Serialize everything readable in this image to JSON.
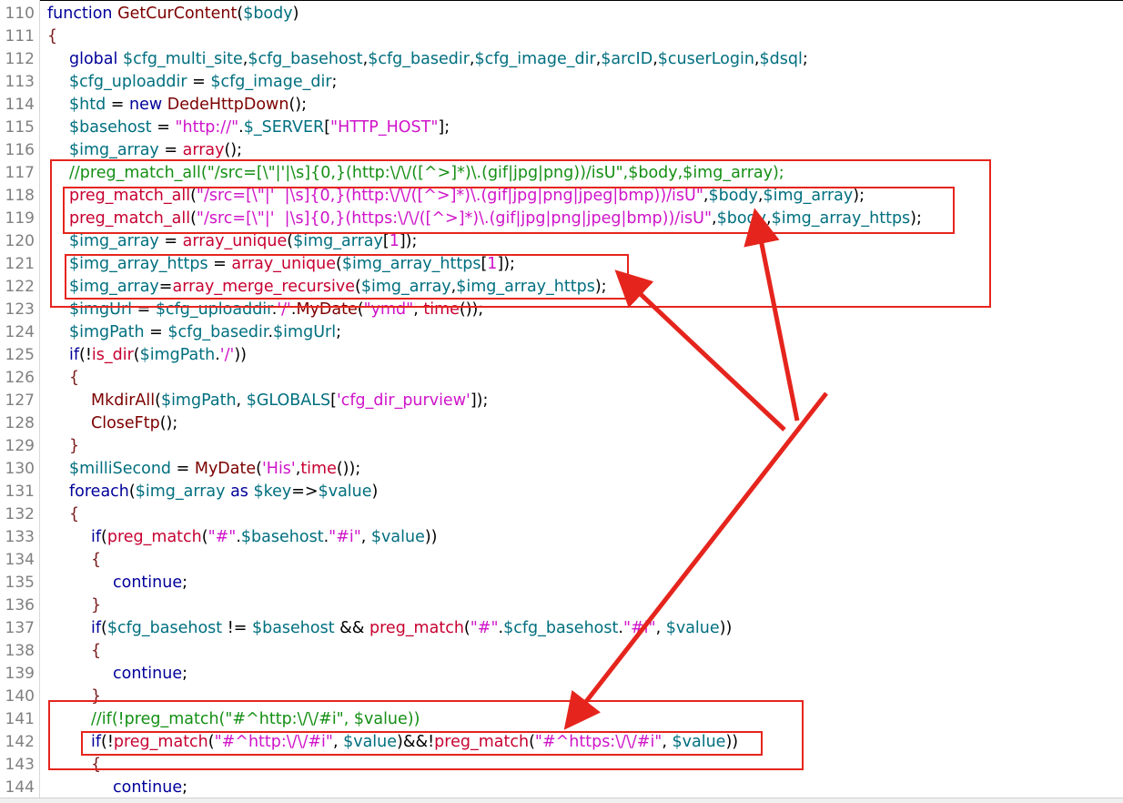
{
  "editor": {
    "lines": [
      {
        "num": "110",
        "indent": 0,
        "tokens": [
          {
            "t": "function ",
            "c": "kw"
          },
          {
            "t": "GetCurContent",
            "c": "fn"
          },
          {
            "t": "(",
            "c": "op"
          },
          {
            "t": "$body",
            "c": "var"
          },
          {
            "t": ")",
            "c": "op"
          }
        ]
      },
      {
        "num": "111",
        "indent": 0,
        "tokens": [
          {
            "t": "{",
            "c": "bk"
          }
        ]
      },
      {
        "num": "112",
        "indent": 1,
        "tokens": [
          {
            "t": "global ",
            "c": "kw"
          },
          {
            "t": "$cfg_multi_site",
            "c": "var"
          },
          {
            "t": ",",
            "c": "op"
          },
          {
            "t": "$cfg_basehost",
            "c": "var"
          },
          {
            "t": ",",
            "c": "op"
          },
          {
            "t": "$cfg_basedir",
            "c": "var"
          },
          {
            "t": ",",
            "c": "op"
          },
          {
            "t": "$cfg_image_dir",
            "c": "var"
          },
          {
            "t": ",",
            "c": "op"
          },
          {
            "t": "$arcID",
            "c": "var"
          },
          {
            "t": ",",
            "c": "op"
          },
          {
            "t": "$cuserLogin",
            "c": "var"
          },
          {
            "t": ",",
            "c": "op"
          },
          {
            "t": "$dsql",
            "c": "var"
          },
          {
            "t": ";",
            "c": "op"
          }
        ]
      },
      {
        "num": "113",
        "indent": 1,
        "tokens": [
          {
            "t": "$cfg_uploaddir",
            "c": "var"
          },
          {
            "t": " = ",
            "c": "op"
          },
          {
            "t": "$cfg_image_dir",
            "c": "var"
          },
          {
            "t": ";",
            "c": "op"
          }
        ]
      },
      {
        "num": "114",
        "indent": 1,
        "tokens": [
          {
            "t": "$htd",
            "c": "var"
          },
          {
            "t": " = ",
            "c": "op"
          },
          {
            "t": "new ",
            "c": "kw"
          },
          {
            "t": "DedeHttpDown",
            "c": "fn"
          },
          {
            "t": "();",
            "c": "op"
          }
        ]
      },
      {
        "num": "115",
        "indent": 1,
        "tokens": [
          {
            "t": "$basehost",
            "c": "var"
          },
          {
            "t": " = ",
            "c": "op"
          },
          {
            "t": "\"http://\"",
            "c": "str"
          },
          {
            "t": ".",
            "c": "op"
          },
          {
            "t": "$_SERVER",
            "c": "var"
          },
          {
            "t": "[",
            "c": "op"
          },
          {
            "t": "\"HTTP_HOST\"",
            "c": "str"
          },
          {
            "t": "];",
            "c": "op"
          }
        ]
      },
      {
        "num": "116",
        "indent": 1,
        "tokens": [
          {
            "t": "$img_array",
            "c": "var"
          },
          {
            "t": " = ",
            "c": "op"
          },
          {
            "t": "array",
            "c": "fnr"
          },
          {
            "t": "();",
            "c": "op"
          }
        ]
      },
      {
        "num": "117",
        "indent": 1,
        "tokens": [
          {
            "t": "//preg_match_all(\"/src=[\\\"|'|\\s]{0,}(http:\\/\\/([^>]*)\\.(gif|jpg|png))/isU\",$body,$img_array);",
            "c": "cm"
          }
        ]
      },
      {
        "num": "118",
        "indent": 1,
        "tokens": [
          {
            "t": "preg_match_all",
            "c": "fnr"
          },
          {
            "t": "(",
            "c": "op"
          },
          {
            "t": "\"/src=[\\\"|'  |\\s]{0,}(http:\\/\\/([^>]*)\\.(gif|jpg|png|jpeg|bmp))/isU\"",
            "c": "str"
          },
          {
            "t": ",",
            "c": "op"
          },
          {
            "t": "$body",
            "c": "var"
          },
          {
            "t": ",",
            "c": "op"
          },
          {
            "t": "$img_array",
            "c": "var"
          },
          {
            "t": ");",
            "c": "op"
          }
        ]
      },
      {
        "num": "119",
        "indent": 1,
        "tokens": [
          {
            "t": "preg_match_all",
            "c": "fnr"
          },
          {
            "t": "(",
            "c": "op"
          },
          {
            "t": "\"/src=[\\\"|'  |\\s]{0,}(https:\\/\\/([^>]*)\\.(gif|jpg|png|jpeg|bmp))/isU\"",
            "c": "str"
          },
          {
            "t": ",",
            "c": "op"
          },
          {
            "t": "$body",
            "c": "var"
          },
          {
            "t": ",",
            "c": "op"
          },
          {
            "t": "$img_array_https",
            "c": "var"
          },
          {
            "t": ");",
            "c": "op"
          }
        ]
      },
      {
        "num": "120",
        "indent": 1,
        "tokens": [
          {
            "t": "$img_array",
            "c": "var"
          },
          {
            "t": " = ",
            "c": "op"
          },
          {
            "t": "array_unique",
            "c": "fnr"
          },
          {
            "t": "(",
            "c": "op"
          },
          {
            "t": "$img_array",
            "c": "var"
          },
          {
            "t": "[",
            "c": "op"
          },
          {
            "t": "1",
            "c": "str"
          },
          {
            "t": "]);",
            "c": "op"
          }
        ]
      },
      {
        "num": "121",
        "indent": 1,
        "tokens": [
          {
            "t": "$img_array_https",
            "c": "var"
          },
          {
            "t": " = ",
            "c": "op"
          },
          {
            "t": "array_unique",
            "c": "fnr"
          },
          {
            "t": "(",
            "c": "op"
          },
          {
            "t": "$img_array_https",
            "c": "var"
          },
          {
            "t": "[",
            "c": "op"
          },
          {
            "t": "1",
            "c": "str"
          },
          {
            "t": "]);",
            "c": "op"
          }
        ]
      },
      {
        "num": "122",
        "indent": 1,
        "tokens": [
          {
            "t": "$img_array",
            "c": "var"
          },
          {
            "t": "=",
            "c": "op"
          },
          {
            "t": "array_merge_recursive",
            "c": "fnr"
          },
          {
            "t": "(",
            "c": "op"
          },
          {
            "t": "$img_array",
            "c": "var"
          },
          {
            "t": ",",
            "c": "op"
          },
          {
            "t": "$img_array_https",
            "c": "var"
          },
          {
            "t": ");",
            "c": "op"
          }
        ]
      },
      {
        "num": "123",
        "indent": 1,
        "tokens": [
          {
            "t": "$imgUrl",
            "c": "var"
          },
          {
            "t": " = ",
            "c": "op"
          },
          {
            "t": "$cfg_uploaddir",
            "c": "var"
          },
          {
            "t": ".",
            "c": "op"
          },
          {
            "t": "'/'",
            "c": "str"
          },
          {
            "t": ".",
            "c": "op"
          },
          {
            "t": "MyDate",
            "c": "fn"
          },
          {
            "t": "(",
            "c": "op"
          },
          {
            "t": "\"ymd\"",
            "c": "str"
          },
          {
            "t": ", ",
            "c": "op"
          },
          {
            "t": "time",
            "c": "fnr"
          },
          {
            "t": "());",
            "c": "op"
          }
        ]
      },
      {
        "num": "124",
        "indent": 1,
        "tokens": [
          {
            "t": "$imgPath",
            "c": "var"
          },
          {
            "t": " = ",
            "c": "op"
          },
          {
            "t": "$cfg_basedir",
            "c": "var"
          },
          {
            "t": ".",
            "c": "op"
          },
          {
            "t": "$imgUrl",
            "c": "var"
          },
          {
            "t": ";",
            "c": "op"
          }
        ]
      },
      {
        "num": "125",
        "indent": 1,
        "tokens": [
          {
            "t": "if",
            "c": "kw"
          },
          {
            "t": "(!",
            "c": "op"
          },
          {
            "t": "is_dir",
            "c": "fnr"
          },
          {
            "t": "(",
            "c": "op"
          },
          {
            "t": "$imgPath",
            "c": "var"
          },
          {
            "t": ".",
            "c": "op"
          },
          {
            "t": "'/'",
            "c": "str"
          },
          {
            "t": "))",
            "c": "op"
          }
        ]
      },
      {
        "num": "126",
        "indent": 1,
        "tokens": [
          {
            "t": "{",
            "c": "bk"
          }
        ]
      },
      {
        "num": "127",
        "indent": 2,
        "tokens": [
          {
            "t": "MkdirAll",
            "c": "fn"
          },
          {
            "t": "(",
            "c": "op"
          },
          {
            "t": "$imgPath",
            "c": "var"
          },
          {
            "t": ", ",
            "c": "op"
          },
          {
            "t": "$GLOBALS",
            "c": "var"
          },
          {
            "t": "[",
            "c": "op"
          },
          {
            "t": "'cfg_dir_purview'",
            "c": "str"
          },
          {
            "t": "]);",
            "c": "op"
          }
        ]
      },
      {
        "num": "128",
        "indent": 2,
        "tokens": [
          {
            "t": "CloseFtp",
            "c": "fn"
          },
          {
            "t": "();",
            "c": "op"
          }
        ]
      },
      {
        "num": "129",
        "indent": 1,
        "tokens": [
          {
            "t": "}",
            "c": "bk"
          }
        ]
      },
      {
        "num": "130",
        "indent": 1,
        "tokens": [
          {
            "t": "$milliSecond",
            "c": "var"
          },
          {
            "t": " = ",
            "c": "op"
          },
          {
            "t": "MyDate",
            "c": "fn"
          },
          {
            "t": "(",
            "c": "op"
          },
          {
            "t": "'His'",
            "c": "str"
          },
          {
            "t": ",",
            "c": "op"
          },
          {
            "t": "time",
            "c": "fnr"
          },
          {
            "t": "());",
            "c": "op"
          }
        ]
      },
      {
        "num": "131",
        "indent": 1,
        "tokens": [
          {
            "t": "foreach",
            "c": "kw"
          },
          {
            "t": "(",
            "c": "op"
          },
          {
            "t": "$img_array",
            "c": "var"
          },
          {
            "t": " as ",
            "c": "kw"
          },
          {
            "t": "$key",
            "c": "var"
          },
          {
            "t": "=>",
            "c": "op"
          },
          {
            "t": "$value",
            "c": "var"
          },
          {
            "t": ")",
            "c": "op"
          }
        ]
      },
      {
        "num": "132",
        "indent": 1,
        "tokens": [
          {
            "t": "{",
            "c": "bk"
          }
        ]
      },
      {
        "num": "133",
        "indent": 2,
        "tokens": [
          {
            "t": "if",
            "c": "kw"
          },
          {
            "t": "(",
            "c": "op"
          },
          {
            "t": "preg_match",
            "c": "fnr"
          },
          {
            "t": "(",
            "c": "op"
          },
          {
            "t": "\"#\"",
            "c": "str"
          },
          {
            "t": ".",
            "c": "op"
          },
          {
            "t": "$basehost",
            "c": "var"
          },
          {
            "t": ".",
            "c": "op"
          },
          {
            "t": "\"#i\"",
            "c": "str"
          },
          {
            "t": ", ",
            "c": "op"
          },
          {
            "t": "$value",
            "c": "var"
          },
          {
            "t": "))",
            "c": "op"
          }
        ]
      },
      {
        "num": "134",
        "indent": 2,
        "tokens": [
          {
            "t": "{",
            "c": "bk"
          }
        ]
      },
      {
        "num": "135",
        "indent": 3,
        "tokens": [
          {
            "t": "continue",
            "c": "kw"
          },
          {
            "t": ";",
            "c": "op"
          }
        ]
      },
      {
        "num": "136",
        "indent": 2,
        "tokens": [
          {
            "t": "}",
            "c": "bk"
          }
        ]
      },
      {
        "num": "137",
        "indent": 2,
        "tokens": [
          {
            "t": "if",
            "c": "kw"
          },
          {
            "t": "(",
            "c": "op"
          },
          {
            "t": "$cfg_basehost",
            "c": "var"
          },
          {
            "t": " != ",
            "c": "op"
          },
          {
            "t": "$basehost",
            "c": "var"
          },
          {
            "t": " && ",
            "c": "op"
          },
          {
            "t": "preg_match",
            "c": "fnr"
          },
          {
            "t": "(",
            "c": "op"
          },
          {
            "t": "\"#\"",
            "c": "str"
          },
          {
            "t": ".",
            "c": "op"
          },
          {
            "t": "$cfg_basehost",
            "c": "var"
          },
          {
            "t": ".",
            "c": "op"
          },
          {
            "t": "\"#i\"",
            "c": "str"
          },
          {
            "t": ", ",
            "c": "op"
          },
          {
            "t": "$value",
            "c": "var"
          },
          {
            "t": "))",
            "c": "op"
          }
        ]
      },
      {
        "num": "138",
        "indent": 2,
        "tokens": [
          {
            "t": "{",
            "c": "bk"
          }
        ]
      },
      {
        "num": "139",
        "indent": 3,
        "tokens": [
          {
            "t": "continue",
            "c": "kw"
          },
          {
            "t": ";",
            "c": "op"
          }
        ]
      },
      {
        "num": "140",
        "indent": 2,
        "tokens": [
          {
            "t": "}",
            "c": "bk"
          }
        ]
      },
      {
        "num": "141",
        "indent": 2,
        "tokens": [
          {
            "t": "//if(!preg_match(\"#^http:\\/\\/#i\", $value))",
            "c": "cm"
          }
        ]
      },
      {
        "num": "142",
        "indent": 2,
        "tokens": [
          {
            "t": "if",
            "c": "kw"
          },
          {
            "t": "(!",
            "c": "op"
          },
          {
            "t": "preg_match",
            "c": "fnr"
          },
          {
            "t": "(",
            "c": "op"
          },
          {
            "t": "\"#^http:\\/\\/#i\"",
            "c": "str"
          },
          {
            "t": ", ",
            "c": "op"
          },
          {
            "t": "$value",
            "c": "var"
          },
          {
            "t": ")&&!",
            "c": "op"
          },
          {
            "t": "preg_match",
            "c": "fnr"
          },
          {
            "t": "(",
            "c": "op"
          },
          {
            "t": "\"#^https:\\/\\/#i\"",
            "c": "str"
          },
          {
            "t": ", ",
            "c": "op"
          },
          {
            "t": "$value",
            "c": "var"
          },
          {
            "t": "))",
            "c": "op"
          }
        ]
      },
      {
        "num": "143",
        "indent": 2,
        "tokens": [
          {
            "t": "{",
            "c": "bk"
          }
        ]
      },
      {
        "num": "144",
        "indent": 3,
        "tokens": [
          {
            "t": "continue",
            "c": "kw"
          },
          {
            "t": ";",
            "c": "op"
          }
        ]
      }
    ]
  },
  "colors": {
    "annotation": "#e5251d",
    "keyword": "#00009a",
    "variable": "#006f7f",
    "string": "#cf14c9",
    "comment": "#148f14",
    "builtin": "#c70030"
  }
}
